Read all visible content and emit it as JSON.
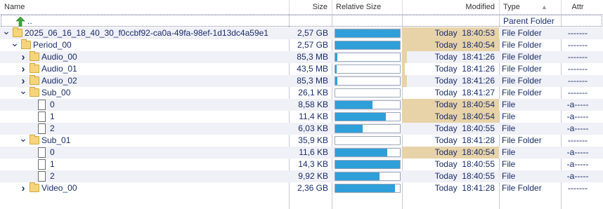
{
  "columns": {
    "name": "Name",
    "size": "Size",
    "relative_size": "Relative Size",
    "modified": "Modified",
    "type": "Type",
    "attr": "Attr"
  },
  "parent_row": {
    "name": "..",
    "type": "Parent Folder"
  },
  "rows": [
    {
      "name": "2025_06_16_18_40_30_f0ccbf92-ca0a-49fa-98ef-1d13dc4a59e1",
      "size": "2,57 GB",
      "rel": 1.0,
      "modified": "Today  18:40:53",
      "type": "File Folder",
      "attr": "-------",
      "kind": "folder",
      "expand": "open",
      "level": 0,
      "modhl": 1.0
    },
    {
      "name": "Period_00",
      "size": "2,57 GB",
      "rel": 1.0,
      "modified": "Today  18:40:54",
      "type": "File Folder",
      "attr": "-------",
      "kind": "folder",
      "expand": "open",
      "level": 1,
      "modhl": 1.0
    },
    {
      "name": "Audio_00",
      "size": "85,3 MB",
      "rel": 0.035,
      "modified": "Today  18:41:26",
      "type": "File Folder",
      "attr": "-------",
      "kind": "folder",
      "expand": "closed",
      "level": 2,
      "modhl": 0.05
    },
    {
      "name": "Audio_01",
      "size": "43,5 MB",
      "rel": 0.02,
      "modified": "Today  18:41:26",
      "type": "File Folder",
      "attr": "-------",
      "kind": "folder",
      "expand": "closed",
      "level": 2,
      "modhl": 0.03
    },
    {
      "name": "Audio_02",
      "size": "85,3 MB",
      "rel": 0.035,
      "modified": "Today  18:41:26",
      "type": "File Folder",
      "attr": "-------",
      "kind": "folder",
      "expand": "closed",
      "level": 2,
      "modhl": 0.05
    },
    {
      "name": "Sub_00",
      "size": "26,1 KB",
      "rel": 0.0,
      "modified": "Today  18:41:27",
      "type": "File Folder",
      "attr": "-------",
      "kind": "folder",
      "expand": "open",
      "level": 2,
      "modhl": 0.0
    },
    {
      "name": "0",
      "size": "8,58 KB",
      "rel": 0.58,
      "modified": "Today  18:40:54",
      "type": "File",
      "attr": "-a-----",
      "kind": "file",
      "expand": "none",
      "level": 3,
      "modhl": 1.0
    },
    {
      "name": "1",
      "size": "11,4 KB",
      "rel": 0.78,
      "modified": "Today  18:40:54",
      "type": "File",
      "attr": "-a-----",
      "kind": "file",
      "expand": "none",
      "level": 3,
      "modhl": 1.0
    },
    {
      "name": "2",
      "size": "6,03 KB",
      "rel": 0.42,
      "modified": "Today  18:40:55",
      "type": "File",
      "attr": "-a-----",
      "kind": "file",
      "expand": "none",
      "level": 3,
      "modhl": 0.0
    },
    {
      "name": "Sub_01",
      "size": "35,9 KB",
      "rel": 0.0,
      "modified": "Today  18:41:28",
      "type": "File Folder",
      "attr": "-------",
      "kind": "folder",
      "expand": "open",
      "level": 2,
      "modhl": 0.0
    },
    {
      "name": "0",
      "size": "11,6 KB",
      "rel": 0.8,
      "modified": "Today  18:40:54",
      "type": "File",
      "attr": "-a-----",
      "kind": "file",
      "expand": "none",
      "level": 3,
      "modhl": 1.0
    },
    {
      "name": "1",
      "size": "14,3 KB",
      "rel": 1.0,
      "modified": "Today  18:40:55",
      "type": "File",
      "attr": "-a-----",
      "kind": "file",
      "expand": "none",
      "level": 3,
      "modhl": 0.0
    },
    {
      "name": "2",
      "size": "9,92 KB",
      "rel": 0.69,
      "modified": "Today  18:40:55",
      "type": "File",
      "attr": "-a-----",
      "kind": "file",
      "expand": "none",
      "level": 3,
      "modhl": 0.0
    },
    {
      "name": "Video_00",
      "size": "2,36 GB",
      "rel": 0.92,
      "modified": "Today  18:41:28",
      "type": "File Folder",
      "attr": "-------",
      "kind": "folder",
      "expand": "closed",
      "level": 2,
      "modhl": 0.0
    }
  ],
  "colors": {
    "bar_fill": "#2e9fd9",
    "modified_highlight": "#e8d3a8",
    "text": "#1a2d6b"
  },
  "icons": {
    "parent": "green-up-arrow-icon",
    "folder": "folder-icon",
    "file": "file-icon",
    "open": "chevron-down-icon",
    "closed": "chevron-right-icon",
    "sort": "sort-ascending-icon"
  }
}
